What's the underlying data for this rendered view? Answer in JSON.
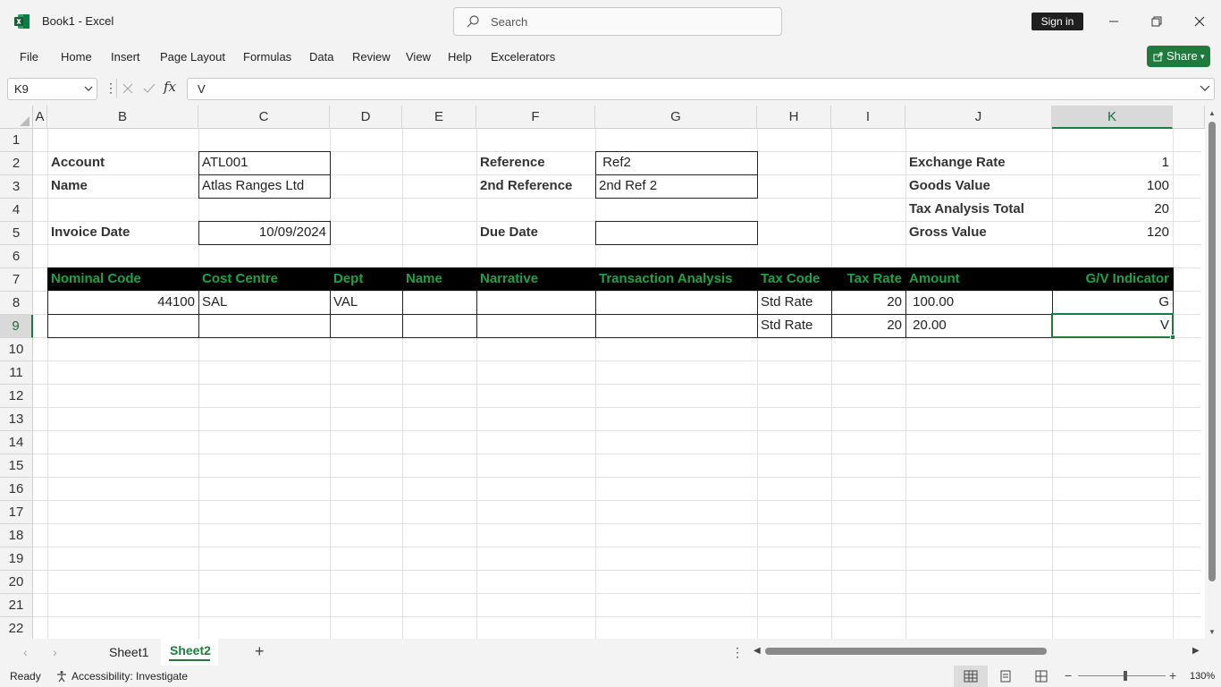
{
  "window": {
    "app_title": "Book1  -  Excel",
    "search_placeholder": "Search",
    "sign_in_label": "Sign in"
  },
  "ribbon": {
    "tabs": [
      "File",
      "Home",
      "Insert",
      "Page Layout",
      "Formulas",
      "Data",
      "Review",
      "View",
      "Help",
      "Excelerators"
    ],
    "share_label": "Share"
  },
  "formula_bar": {
    "name_box": "K9",
    "formula": "V"
  },
  "columns": [
    "A",
    "B",
    "C",
    "D",
    "E",
    "F",
    "G",
    "H",
    "I",
    "J",
    "K"
  ],
  "rows": [
    "1",
    "2",
    "3",
    "4",
    "5",
    "6",
    "7",
    "8",
    "9",
    "10",
    "11",
    "12",
    "13",
    "14",
    "15",
    "16",
    "17",
    "18",
    "19",
    "20",
    "21",
    "22"
  ],
  "selected_cell": {
    "column": "K",
    "row": "9"
  },
  "cells": {
    "B2": "Account",
    "C2": "ATL001",
    "F2": "Reference",
    "G2": " Ref2",
    "J2": "Exchange Rate",
    "K2": "1",
    "B3": "Name",
    "C3": "Atlas Ranges Ltd",
    "F3": "2nd Reference",
    "G3": "2nd Ref 2",
    "J3": "Goods Value",
    "K3": "100",
    "J4": "Tax Analysis Total",
    "K4": "20",
    "B5": "Invoice Date",
    "C5": "10/09/2024",
    "F5": "Due Date",
    "G5": "",
    "J5": "Gross Value",
    "K5": "120",
    "B7": "Nominal Code",
    "C7": "Cost Centre",
    "D7": "Dept",
    "E7": "Name",
    "F7": "Narrative",
    "G7": "Transaction Analysis",
    "H7": "Tax Code",
    "I7": "Tax Rate",
    "J7": "Amount",
    "K7": "G/V Indicator",
    "B8": "44100",
    "C8": "SAL",
    "D8": "VAL",
    "H8": "Std Rate",
    "I8": "20",
    "J8": " 100.00",
    "K8": "G",
    "H9": "Std Rate",
    "I9": "20",
    "J9": " 20.00",
    "K9": "V"
  },
  "sheets": {
    "tabs": [
      "Sheet1",
      "Sheet2"
    ],
    "active": "Sheet2"
  },
  "status": {
    "mode": "Ready",
    "accessibility": "Accessibility: Investigate",
    "zoom": "130%"
  },
  "colors": {
    "accent": "#1e7b3d",
    "header_band": "#000000",
    "header_text": "#1ea345"
  }
}
